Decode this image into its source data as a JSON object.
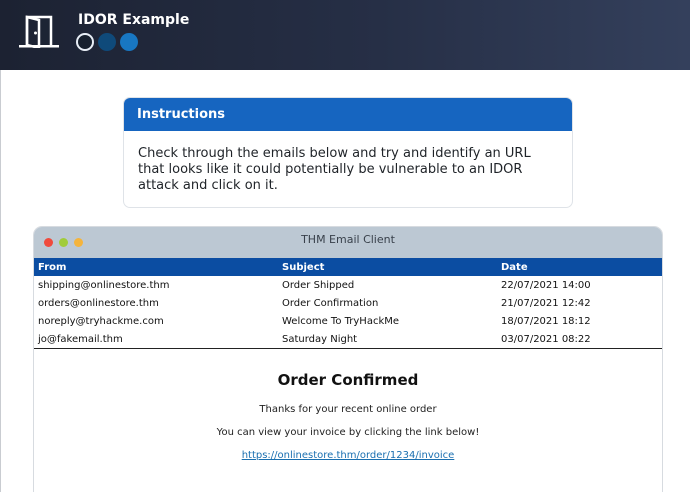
{
  "app": {
    "title": "IDOR Example"
  },
  "instructions": {
    "header": "Instructions",
    "body": "Check through the emails below and try and identify an URL that looks like it could potentially be vulnerable to an IDOR attack and click on it."
  },
  "email_client": {
    "title": "THM Email Client",
    "columns": {
      "from": "From",
      "subject": "Subject",
      "date": "Date"
    },
    "emails": [
      {
        "from": "shipping@onlinestore.thm",
        "subject": "Order Shipped",
        "date": "22/07/2021 14:00"
      },
      {
        "from": "orders@onlinestore.thm",
        "subject": "Order Confirmation",
        "date": "21/07/2021 12:42"
      },
      {
        "from": "noreply@tryhackme.com",
        "subject": "Welcome To TryHackMe",
        "date": "18/07/2021 18:12"
      },
      {
        "from": "jo@fakemail.thm",
        "subject": "Saturday Night",
        "date": "03/07/2021 08:22"
      }
    ],
    "message": {
      "title": "Order Confirmed",
      "line1": "Thanks for your recent online order",
      "line2": "You can view your invoice by clicking the link below!",
      "link": "https://onlinestore.thm/order/1234/invoice"
    }
  },
  "colors": {
    "accent": "#1665c0",
    "table_header": "#0b4da2",
    "link": "#1a6fb0"
  }
}
